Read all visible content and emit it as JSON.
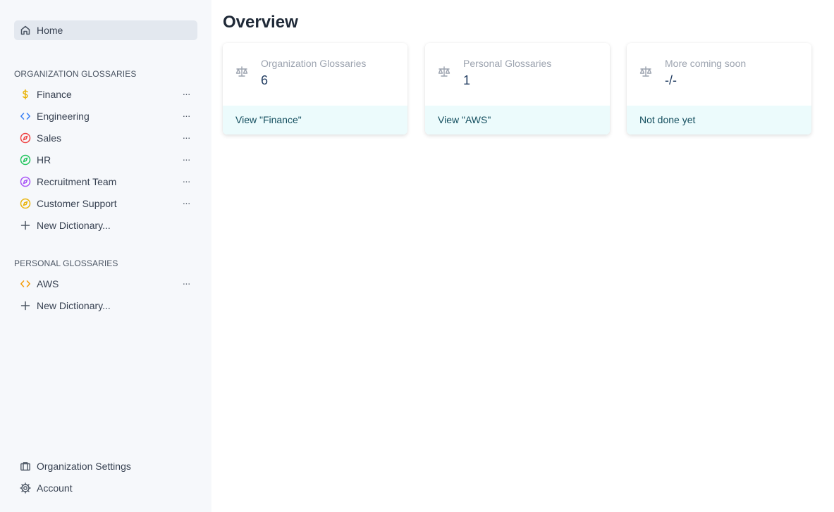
{
  "sidebar": {
    "home": {
      "label": "Home",
      "icon": "home-icon"
    },
    "org_section_title": "ORGANIZATION GLOSSARIES",
    "org_items": [
      {
        "label": "Finance",
        "icon": "dollar-icon",
        "color": "#eab308"
      },
      {
        "label": "Engineering",
        "icon": "code-icon",
        "color": "#3b82f6"
      },
      {
        "label": "Sales",
        "icon": "compass-icon",
        "color": "#ef4444"
      },
      {
        "label": "HR",
        "icon": "compass-icon",
        "color": "#22c55e"
      },
      {
        "label": "Recruitment Team",
        "icon": "compass-icon",
        "color": "#a855f7"
      },
      {
        "label": "Customer Support",
        "icon": "compass-icon",
        "color": "#eab308"
      }
    ],
    "org_new": "New Dictionary...",
    "personal_section_title": "PERSONAL GLOSSARIES",
    "personal_items": [
      {
        "label": "AWS",
        "icon": "code-icon",
        "color": "#f59e0b"
      }
    ],
    "personal_new": "New Dictionary...",
    "org_settings": "Organization Settings",
    "account": "Account",
    "more_label": "···"
  },
  "main": {
    "title": "Overview",
    "cards": [
      {
        "label": "Organization Glossaries",
        "value": "6",
        "footer": "View \"Finance\""
      },
      {
        "label": "Personal Glossaries",
        "value": "1",
        "footer": "View \"AWS\""
      },
      {
        "label": "More coming soon",
        "value": "-/-",
        "footer": "Not done yet"
      }
    ]
  }
}
